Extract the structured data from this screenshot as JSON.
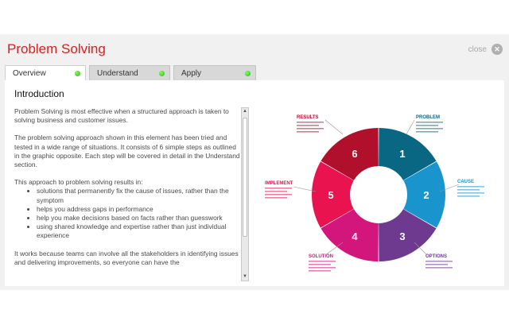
{
  "app": {
    "title": "Problem Solving",
    "close_label": "close"
  },
  "tabs": [
    {
      "label": "Overview",
      "active": true
    },
    {
      "label": "Understand",
      "active": false
    },
    {
      "label": "Apply",
      "active": false
    }
  ],
  "content": {
    "heading": "Introduction",
    "p1": "Problem Solving is most effective when a structured approach is taken to solving business and customer issues.",
    "p2": "The problem solving approach shown in this element has been tried and tested in a wide range of situations.  It consists of 6 simple steps as outlined in the graphic opposite. Each step will be covered in detail in the Understand section.",
    "p3": "This approach to problem solving results in:",
    "bullets": [
      "solutions that permanently fix the cause of issues, rather than the symptom",
      "helps you address gaps in performance",
      "help you make decisions based on facts rather than guesswork",
      "using shared knowledge and expertise rather than just individual experience"
    ],
    "p4": "It works because teams can involve all the stakeholders in identifying issues and delivering improvements, so everyone can have the"
  },
  "diagram": {
    "segments": [
      {
        "number": "1",
        "label": "PROBLEM",
        "color": "#0a6784"
      },
      {
        "number": "2",
        "label": "CAUSE",
        "color": "#1a94cc"
      },
      {
        "number": "3",
        "label": "OPTIONS",
        "color": "#6d3a8f"
      },
      {
        "number": "4",
        "label": "SOLUTION",
        "color": "#d2167b"
      },
      {
        "number": "5",
        "label": "IMPLEMENT",
        "color": "#e8134f"
      },
      {
        "number": "6",
        "label": "RESULTS",
        "color": "#b0102c"
      }
    ]
  }
}
